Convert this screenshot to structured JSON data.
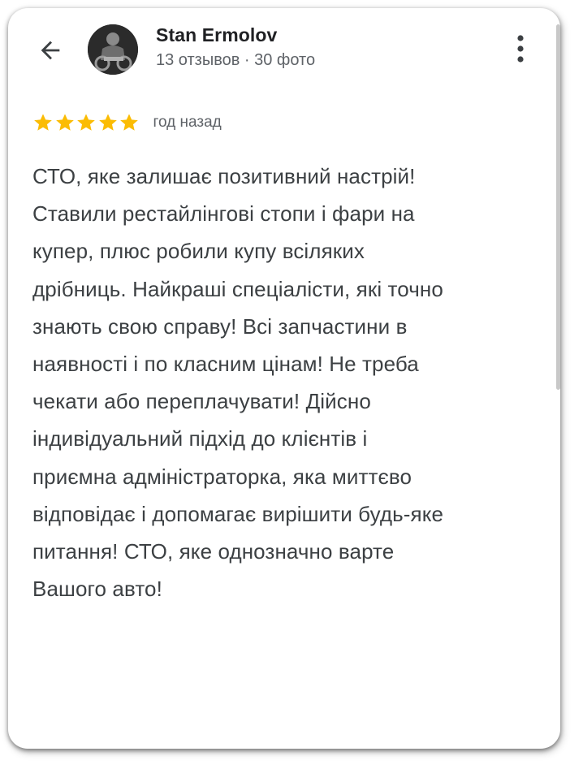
{
  "header": {
    "back_icon": "arrow-left-icon",
    "author_name": "Stan Ermolov",
    "author_meta": "13 отзывов · 30 фото",
    "more_icon": "more-vertical-icon"
  },
  "review": {
    "rating": 5,
    "max_rating": 5,
    "star_color": "#fbbc04",
    "time_ago": "год назад",
    "text": "СТО, яке залишає позитивний настрій!\nСтавили рестайлінгові стопи і фари на\nкупер, плюс робили купу всіляких\nдрібниць. Найкраші спеціалісти, які точно\nзнають свою справу! Всі запчастини в\nнаявності і по класним цінам! Не треба\nчекати або переплачувати! Дійсно\nіндивідуальний підхід до клієнтів і\nприємна адміністраторка, яка миттєво\nвідповідає і допомагає вирішити будь-яке\nпитання! СТО, яке однозначно варте\nВашого авто!"
  }
}
